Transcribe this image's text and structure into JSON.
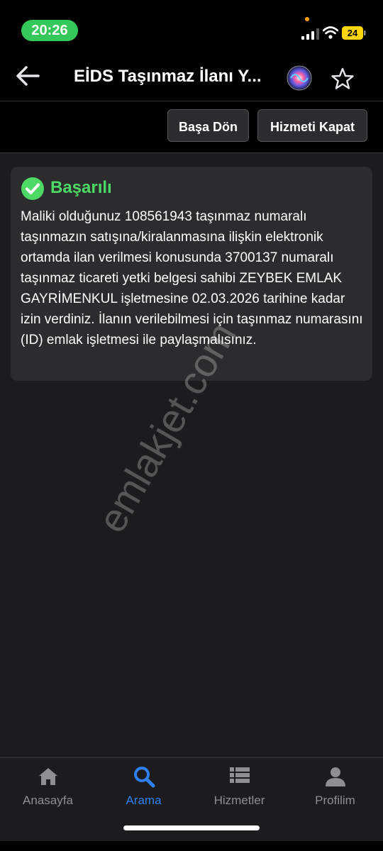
{
  "status_bar": {
    "time": "20:26",
    "battery_level": "24",
    "accent_green": "#34c759"
  },
  "nav": {
    "title": "EİDS Taşınmaz İlanı Y...",
    "back_icon": "arrow-left-icon",
    "assistant_icon": "siri-icon",
    "favorite_icon": "star-outline-icon"
  },
  "actions": {
    "home_label": "Başa Dön",
    "close_label": "Hizmeti Kapat"
  },
  "message": {
    "status_label": "Başarılı",
    "status_icon": "check-circle-icon",
    "status_color": "#4cd964",
    "body": "Maliki olduğunuz 108561943 taşınmaz numaralı taşınmazın satışına/kiralanmasına ilişkin elektronik ortamda ilan verilmesi konusunda 3700137 numaralı taşınmaz ticareti yetki belgesi sahibi ZEYBEK EMLAK GAYRİMENKUL işletmesine 02.03.2026 tarihine kadar izin verdiniz. İlanın verilebilmesi için taşınmaz numarasını (ID) emlak işletmesi ile paylaşmalısınız."
  },
  "watermark": {
    "text": "emlakjet.com"
  },
  "tabs": [
    {
      "label": "Anasayfa",
      "icon": "home-icon",
      "active": false
    },
    {
      "label": "Arama",
      "icon": "search-icon",
      "active": true
    },
    {
      "label": "Hizmetler",
      "icon": "list-icon",
      "active": false
    },
    {
      "label": "Profilim",
      "icon": "person-icon",
      "active": false
    }
  ],
  "colors": {
    "active_tab": "#2f80ed",
    "inactive_tab": "#8e8e93",
    "card_bg": "#2c2c2e",
    "screen_bg": "#1c1c1e"
  }
}
